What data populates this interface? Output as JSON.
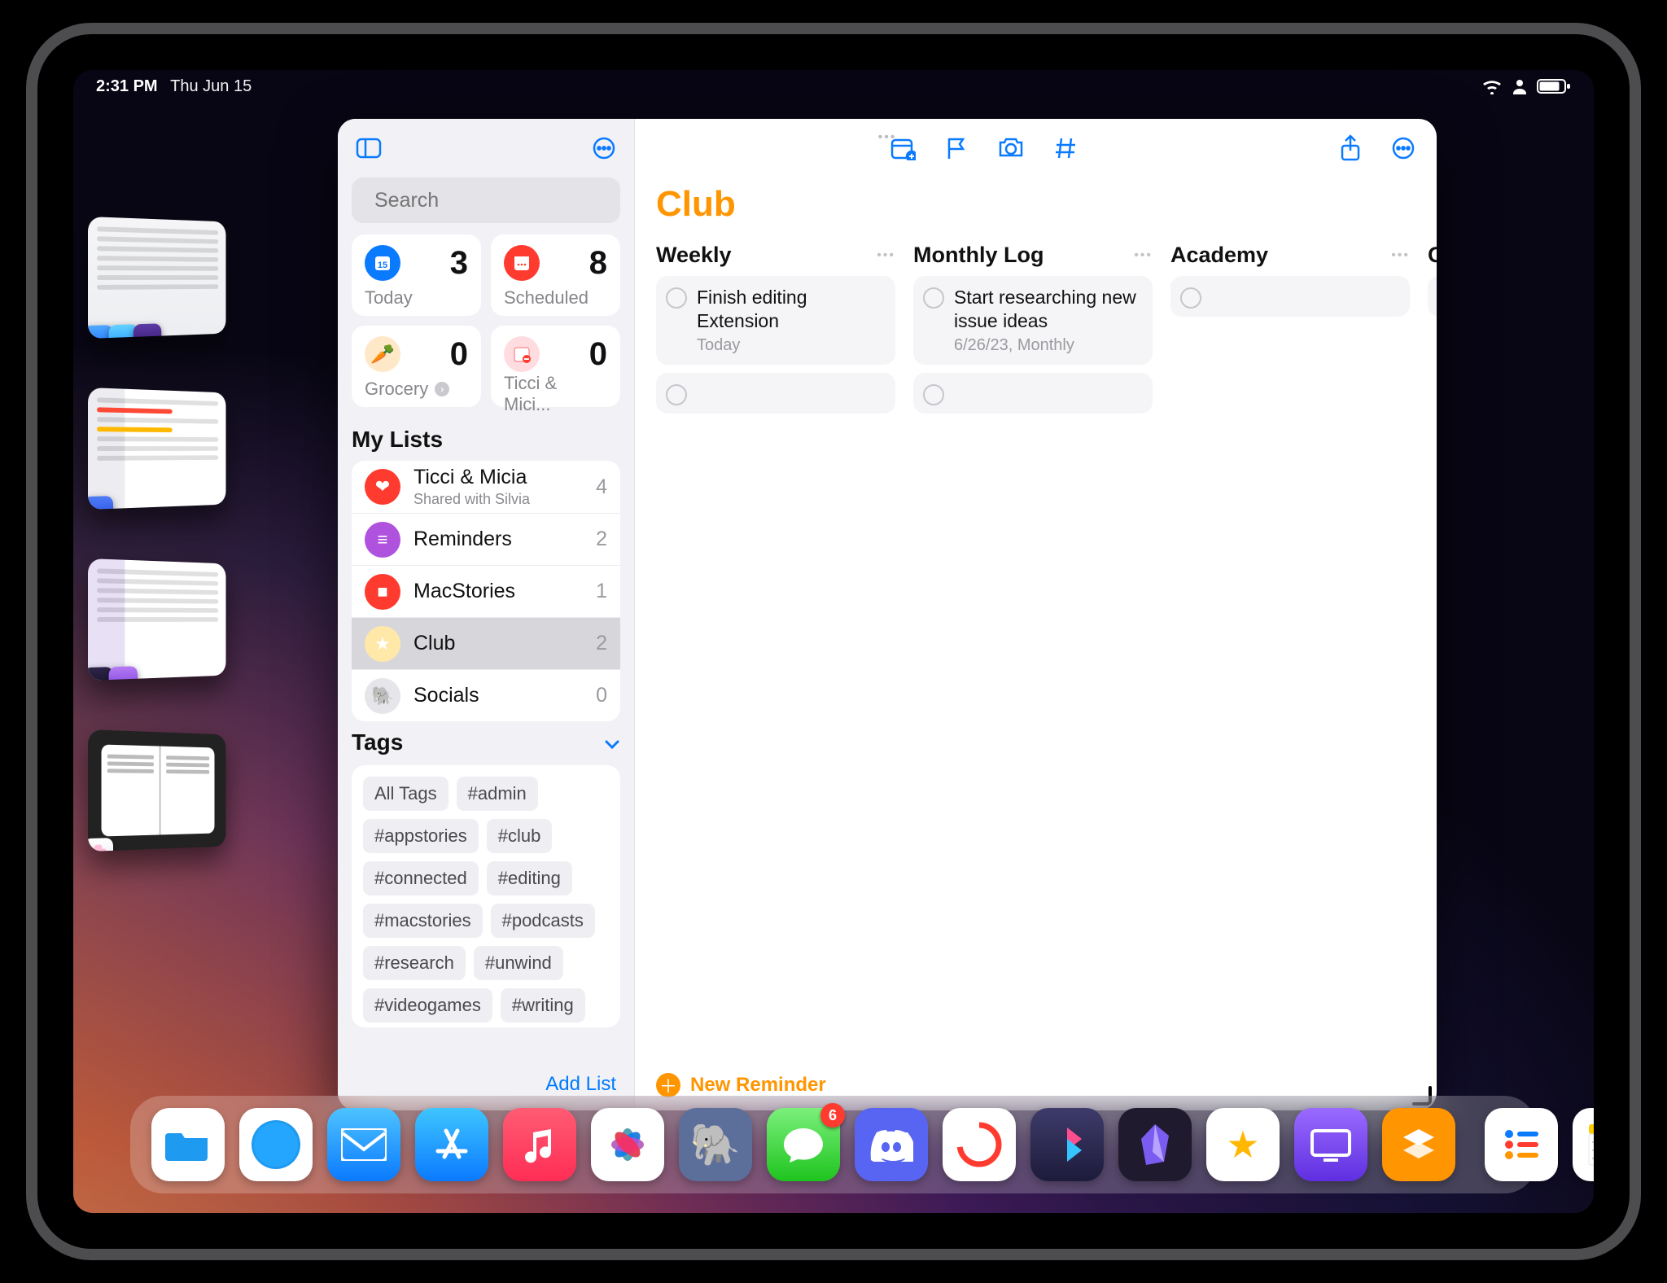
{
  "status": {
    "time": "2:31 PM",
    "date": "Thu Jun 15"
  },
  "search": {
    "placeholder": "Search"
  },
  "smart": [
    {
      "label": "Today",
      "count": "3",
      "icon_bg": "#0A7AFF"
    },
    {
      "label": "Scheduled",
      "count": "8",
      "icon_bg": "#FF3B30"
    },
    {
      "label": "Grocery",
      "count": "0",
      "icon_bg": "#FFE8C7",
      "has_chevron": true
    },
    {
      "label": "Ticci & Mici...",
      "count": "0",
      "icon_bg": "#FFDCE0"
    }
  ],
  "sections": {
    "lists": "My Lists",
    "tags": "Tags"
  },
  "lists": [
    {
      "name": "Ticci & Micia",
      "sub": "Shared with Silvia",
      "count": "4",
      "icon_bg": "#FF3B30",
      "glyph": "❤"
    },
    {
      "name": "Reminders",
      "count": "2",
      "icon_bg": "#AF52DE",
      "glyph": "≡"
    },
    {
      "name": "MacStories",
      "count": "1",
      "icon_bg": "#FF3B30",
      "glyph": "■"
    },
    {
      "name": "Club",
      "count": "2",
      "icon_bg": "#FFE8A8",
      "glyph": "★",
      "selected": true
    },
    {
      "name": "Socials",
      "count": "0",
      "icon_bg": "#E5E5EA",
      "glyph": "🐘"
    }
  ],
  "tags": [
    "All Tags",
    "#admin",
    "#appstories",
    "#club",
    "#connected",
    "#editing",
    "#macstories",
    "#podcasts",
    "#research",
    "#unwind",
    "#videogames",
    "#writing"
  ],
  "sidebar_footer": {
    "add_list": "Add List"
  },
  "main": {
    "title": "Club",
    "new_reminder": "New Reminder",
    "columns": [
      {
        "header": "Weekly",
        "items": [
          {
            "title": "Finish editing Extension",
            "sub": "Today"
          }
        ]
      },
      {
        "header": "Monthly Log",
        "items": [
          {
            "title": "Start researching new issue ideas",
            "sub": "6/26/23, Monthly"
          }
        ]
      },
      {
        "header": "Academy",
        "items": []
      },
      {
        "header": "Othe",
        "items": [],
        "cut": true
      }
    ]
  },
  "dock_badge": "6",
  "colors": {
    "accent": "#007AFF",
    "orange": "#FF9500",
    "red": "#FF3B30"
  }
}
